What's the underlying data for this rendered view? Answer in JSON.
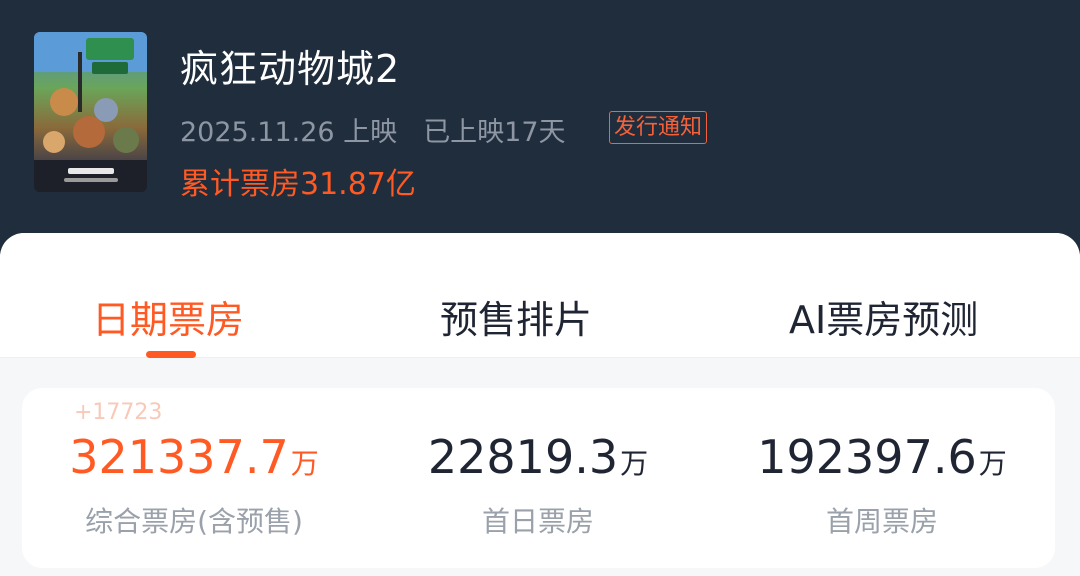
{
  "movie": {
    "title": "疯狂动物城2",
    "release_date": "2025.11.26 上映",
    "days_showing": "已上映17天",
    "notice_badge": "发行通知",
    "total_box_office": "累计票房31.87亿"
  },
  "tabs": [
    {
      "label": "日期票房",
      "active": true
    },
    {
      "label": "预售排片",
      "active": false
    },
    {
      "label": "AI票房预测",
      "active": false
    }
  ],
  "stats": [
    {
      "delta": "+17723",
      "value": "321337.7",
      "unit": "万",
      "label": "综合票房(含预售)"
    },
    {
      "value": "22819.3",
      "unit": "万",
      "label": "首日票房"
    },
    {
      "value": "192397.6",
      "unit": "万",
      "label": "首周票房"
    }
  ],
  "colors": {
    "header_bg": "#1f2d3d",
    "accent": "#ff5a23",
    "muted_text": "#9aa1ab"
  }
}
